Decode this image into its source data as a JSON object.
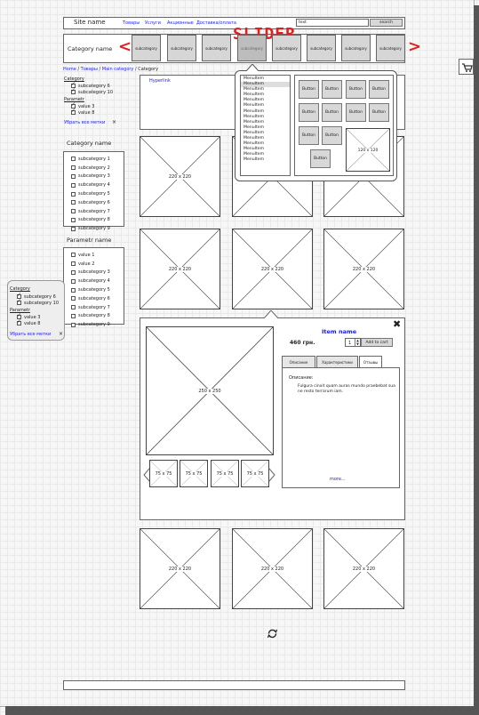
{
  "header": {
    "site_name": "Site name",
    "nav": [
      "Товары",
      "Услуги",
      "Акционные",
      "Доставка/оплата"
    ],
    "search_placeholder": "text",
    "search_button": "search"
  },
  "slider": {
    "category_name": "Category name",
    "annotation": "SLIDER",
    "prev_glyph": "<",
    "next_glyph": ">",
    "items": [
      "subcategory",
      "subcategory",
      "subcategory",
      "subcategory",
      "subcategory",
      "subcategory",
      "subcategory",
      "subcategory"
    ]
  },
  "breadcrumb": [
    "Home",
    "Товары",
    "Main category",
    "Category"
  ],
  "hyperlink": "Hyperlink",
  "active_filters": {
    "groups": [
      {
        "title": "Category",
        "items": [
          "subcategory 6",
          "subcategory 10"
        ]
      },
      {
        "title": "Parametr",
        "items": [
          "value 3",
          "value 8"
        ]
      }
    ],
    "clear_label": "Убрать все метки",
    "close_glyph": "×"
  },
  "category_filter": {
    "title": "Category name",
    "items": [
      "subcategory 1",
      "subcategory 2",
      "subcategory 3",
      "subcategory 4",
      "subcategory 5",
      "subcategory 6",
      "subcategory 7",
      "subcategory 8",
      "subcategory 9"
    ]
  },
  "parametr_filter": {
    "title": "Parametr name",
    "items": [
      "value 1",
      "value 2",
      "subcategory 3",
      "subcategory 4",
      "subcategory 5",
      "subcategory 6",
      "subcategory 7",
      "subcategory 8",
      "subcategory 9"
    ]
  },
  "dropdown": {
    "menu_items": [
      "MenuItem",
      "MenuItem",
      "MenuItem",
      "MenuItem",
      "MenuItem",
      "MenuItem",
      "MenuItem",
      "MenuItem",
      "MenuItem",
      "MenuItem",
      "MenuItem",
      "MenuItem",
      "MenuItem",
      "MenuItem",
      "MenuItem",
      "MenuItem"
    ],
    "button_label": "Button",
    "image_label": "120 x 120"
  },
  "product_image_label": "220 x 220",
  "item_detail": {
    "title": "Item name",
    "price": "460 грн.",
    "quantity": "1",
    "add_to_cart": "Add to cart",
    "close_glyph": "✖",
    "main_image_label": "250 x 250",
    "thumb_label": "75 x 75",
    "tabs": [
      "Описание",
      "Характеристики",
      "Отзывы"
    ],
    "description_heading": "Описание:",
    "description_text": "Fulgura cinxit quam auras mundo praebebat sua ne resto terrarum iam.",
    "more_link": "more..."
  },
  "cart_icon": "cart-icon",
  "loader_icon": "refresh-icon"
}
